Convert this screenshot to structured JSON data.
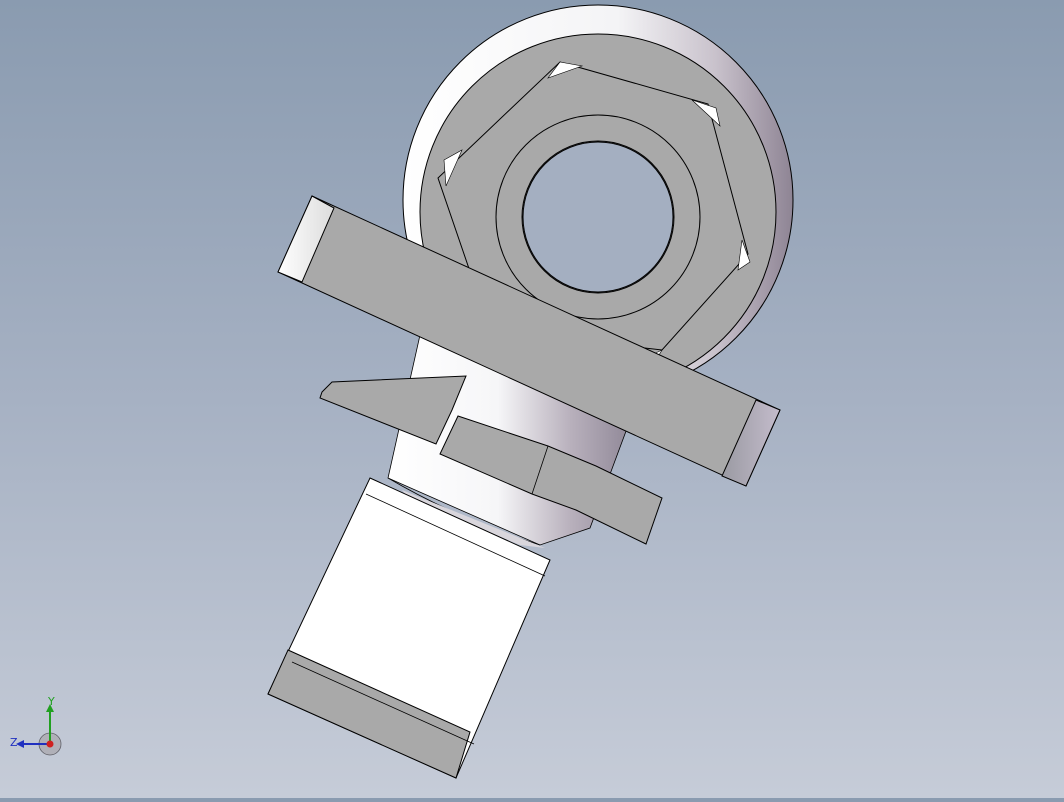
{
  "view": {
    "background_top": "#8a9bb0",
    "background_bottom": "#c6ccd8"
  },
  "model": {
    "face_color": "#a9a9a9",
    "highlight_color": "#ffffff",
    "edge_color": "#000000"
  },
  "triad": {
    "x_axis": {
      "label": "",
      "color": "#d02020"
    },
    "y_axis": {
      "label": "Y",
      "color": "#20a020"
    },
    "z_axis": {
      "label": "Z",
      "color": "#2030c0"
    }
  }
}
